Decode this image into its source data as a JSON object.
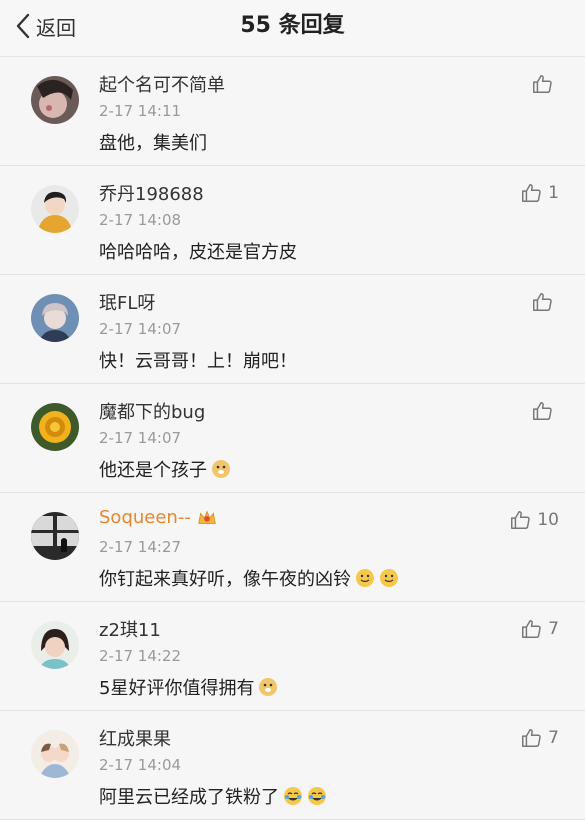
{
  "header": {
    "back_label": "返回",
    "title": "55 条回复"
  },
  "comments": [
    {
      "name": "起个名可不简单",
      "time": "2-17 14:11",
      "text": "盘他，集美们",
      "likes": ""
    },
    {
      "name": "乔丹198688",
      "time": "2-17 14:08",
      "text": "哈哈哈哈，皮还是官方皮",
      "likes": "1"
    },
    {
      "name": "珉FL呀",
      "time": "2-17 14:07",
      "text": "快！云哥哥！上！崩吧！",
      "likes": ""
    },
    {
      "name": "魔都下的bug",
      "time": "2-17 14:07",
      "text": "他还是个孩子",
      "likes": ""
    },
    {
      "name": "Soqueen--",
      "time": "2-17 14:27",
      "text": "你钉起来真好听，像午夜的凶铃",
      "likes": "10"
    },
    {
      "name": "z2琪11",
      "time": "2-17 14:22",
      "text": "5星好评你值得拥有",
      "likes": "7"
    },
    {
      "name": "红成果果",
      "time": "2-17 14:04",
      "text": "阿里云已经成了铁粉了",
      "likes": "7"
    }
  ],
  "colors": {
    "vip_name": "#e8862d",
    "muted": "#9a9a9a"
  }
}
